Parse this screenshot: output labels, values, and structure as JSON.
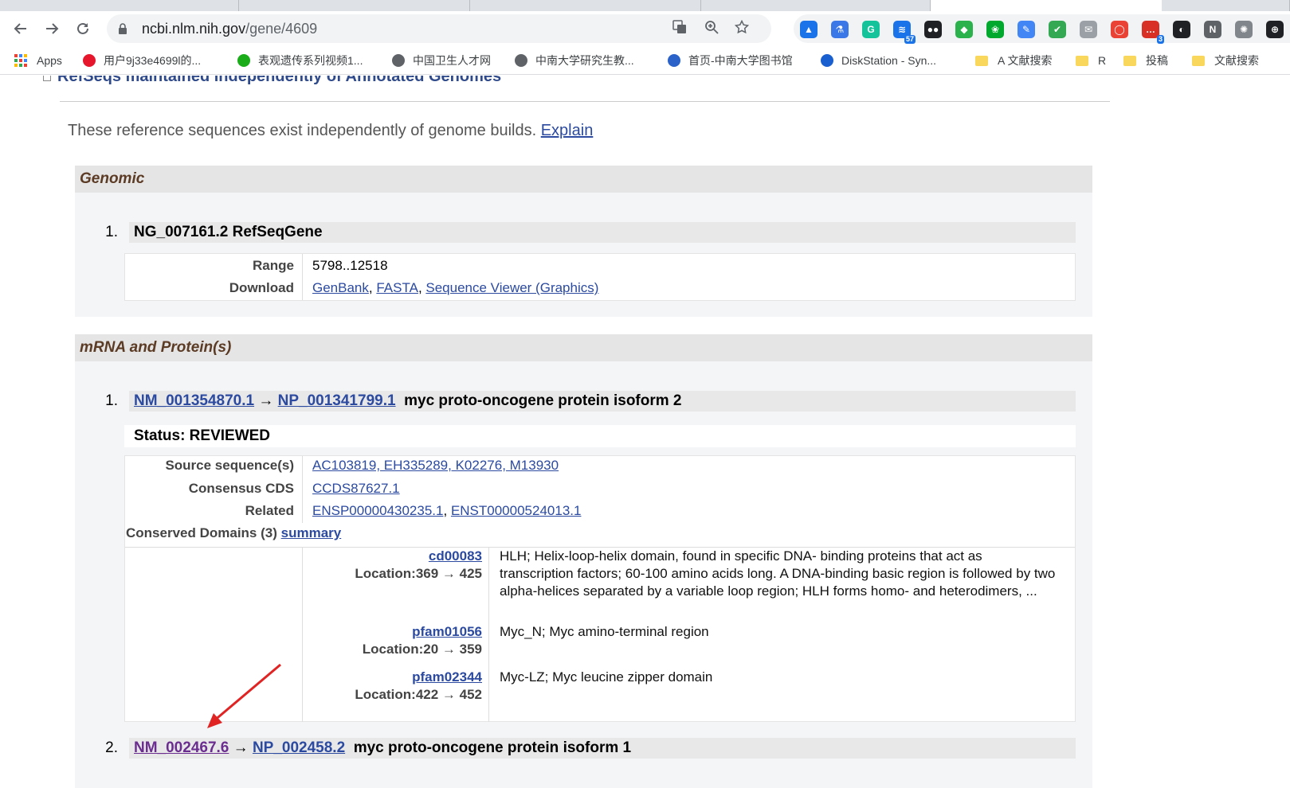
{
  "browser": {
    "url_host": "ncbi.nlm.nih.gov",
    "url_path": "/gene/4609"
  },
  "extensions": [
    {
      "icon": "blue-hat-extension-icon",
      "color": "#1a73e8",
      "glyph": "▲",
      "badge": ""
    },
    {
      "icon": "flask-extension-icon",
      "color": "#3b78e7",
      "glyph": "⚗",
      "badge": ""
    },
    {
      "icon": "grammarly-icon",
      "color": "#15c39a",
      "glyph": "G",
      "badge": ""
    },
    {
      "icon": "rss-extension-icon",
      "color": "#1a73e8",
      "glyph": "≋",
      "badge": "57"
    },
    {
      "icon": "glasses-extension-icon",
      "color": "#202124",
      "glyph": "●●",
      "badge": ""
    },
    {
      "icon": "feedly-icon",
      "color": "#2bb24c",
      "glyph": "◆",
      "badge": ""
    },
    {
      "icon": "evernote-icon",
      "color": "#00a82d",
      "glyph": "❀",
      "badge": ""
    },
    {
      "icon": "blue-edit-extension-icon",
      "color": "#4285f4",
      "glyph": "✎",
      "badge": ""
    },
    {
      "icon": "check-image-extension-icon",
      "color": "#34a853",
      "glyph": "✔",
      "badge": ""
    },
    {
      "icon": "mail-extension-icon",
      "color": "#9aa0a6",
      "glyph": "✉",
      "badge": ""
    },
    {
      "icon": "color-ring-extension-icon",
      "color": "#ea4335",
      "glyph": "◯",
      "badge": ""
    },
    {
      "icon": "red-calendar-extension-icon",
      "color": "#d93025",
      "glyph": "…",
      "badge": "3"
    },
    {
      "icon": "black-square-extension-icon",
      "color": "#202124",
      "glyph": "◐",
      "badge": ""
    },
    {
      "icon": "new-extension-icon",
      "color": "#5f6368",
      "glyph": "N",
      "badge": ""
    },
    {
      "icon": "brain-extension-icon",
      "color": "#80868b",
      "glyph": "✺",
      "badge": ""
    },
    {
      "icon": "puzzle-extension-icon",
      "color": "#202124",
      "glyph": "⊕",
      "badge": ""
    }
  ],
  "bookmarks": [
    {
      "label": "Apps",
      "icon": "apps-grid-icon",
      "type": "apps"
    },
    {
      "label": "用户9j33e4699l的...",
      "icon": "weibo-icon",
      "type": "site",
      "color": "#e6162d"
    },
    {
      "label": "表观遗传系列视频1...",
      "icon": "wechat-icon",
      "type": "site",
      "color": "#1aad19"
    },
    {
      "label": "中国卫生人才网",
      "icon": "globe-icon",
      "type": "site",
      "color": "#5f6368"
    },
    {
      "label": "中南大学研究生教...",
      "icon": "globe-icon",
      "type": "site",
      "color": "#5f6368"
    },
    {
      "label": "首页-中南大学图书馆",
      "icon": "library-logo-icon",
      "type": "site",
      "color": "#2a62c9"
    },
    {
      "label": "DiskStation - Syn...",
      "icon": "dsm-icon",
      "type": "site",
      "color": "#1a5fcf"
    },
    {
      "label": "A 文献搜索",
      "icon": "folder-icon",
      "type": "folder"
    },
    {
      "label": "R",
      "icon": "folder-icon",
      "type": "folder"
    },
    {
      "label": "投稿",
      "icon": "folder-icon",
      "type": "folder"
    },
    {
      "label": "文献搜索",
      "icon": "folder-icon",
      "type": "folder"
    }
  ],
  "page": {
    "cut_heading": "RefSeqs maintained independently of Annotated Genomes",
    "intro_text": "These reference sequences exist independently of genome builds.",
    "intro_link": "Explain",
    "genomic": {
      "title": "Genomic",
      "item_num": "1.",
      "item_title": "NG_007161.2 RefSeqGene",
      "range_label": "Range",
      "range_value": "5798..12518",
      "download_label": "Download",
      "download_links": [
        "GenBank",
        "FASTA",
        "Sequence Viewer (Graphics)"
      ]
    },
    "mrna": {
      "title": "mRNA and Protein(s)",
      "item1": {
        "num": "1.",
        "nm": "NM_001354870.1",
        "arrow": "→",
        "np": "NP_001341799.1",
        "desc": "myc proto-oncogene protein isoform 2",
        "status": "Status: REVIEWED",
        "source_label": "Source sequence(s)",
        "source_value": "AC103819, EH335289, K02276, M13930",
        "ccds_label": "Consensus CDS",
        "ccds_value": "CCDS87627.1",
        "related_label": "Related",
        "related_links": [
          "ENSP00000430235.1",
          "ENST00000524013.1"
        ],
        "conserved_label": "Conserved Domains (3)",
        "conserved_link": "summary",
        "domains": [
          {
            "id": "cd00083",
            "location": "Location:369 → 425",
            "desc": "HLH; Helix-loop-helix domain, found in specific DNA- binding proteins that act as transcription factors; 60-100 amino acids long. A DNA-binding basic region is followed by two alpha-helices separated by a variable loop region; HLH forms homo- and heterodimers, ..."
          },
          {
            "id": "pfam01056",
            "location": "Location:20 → 359",
            "desc": "Myc_N; Myc amino-terminal region"
          },
          {
            "id": "pfam02344",
            "location": "Location:422 → 452",
            "desc": "Myc-LZ; Myc leucine zipper domain"
          }
        ]
      },
      "item2": {
        "num": "2.",
        "nm": "NM_002467.6",
        "arrow": "→",
        "np": "NP_002458.2",
        "desc": "myc proto-oncogene protein isoform 1"
      }
    }
  },
  "annotation_arrow_color": "#e02424"
}
